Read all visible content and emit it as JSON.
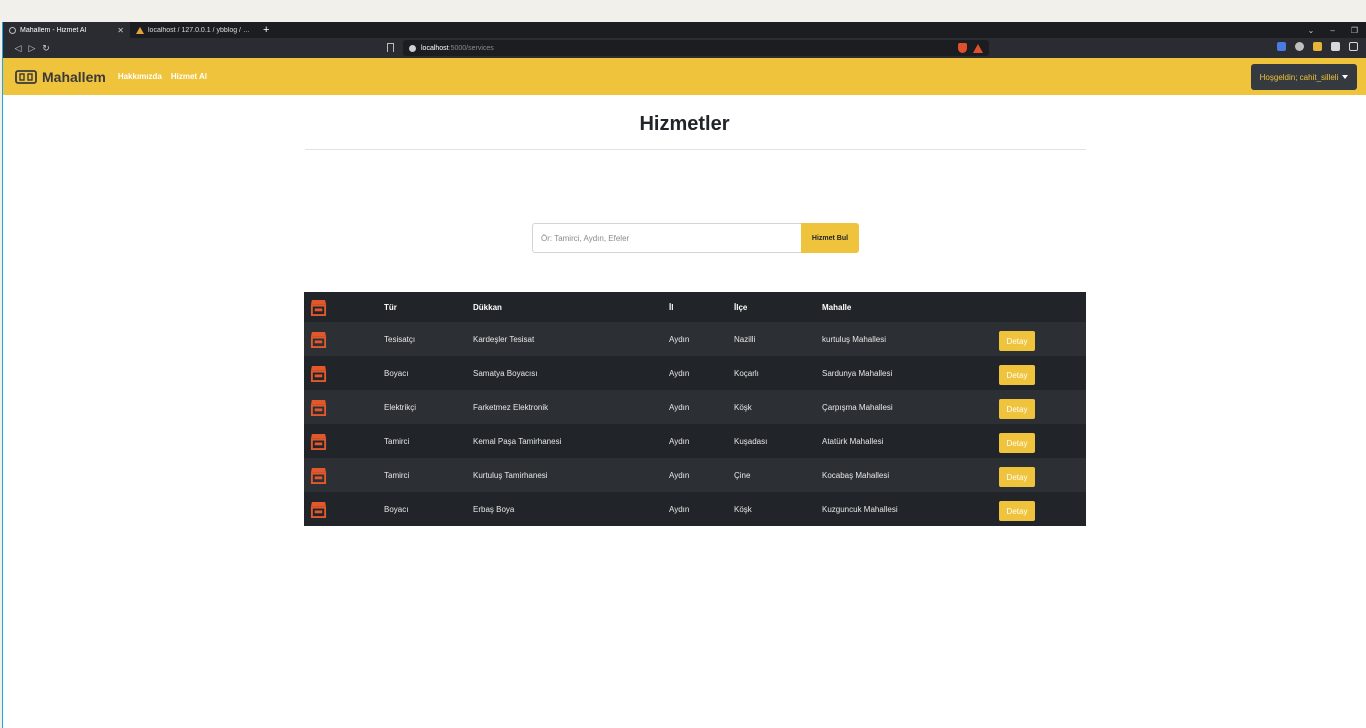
{
  "browser": {
    "tabs": [
      {
        "title": "Mahallem - Hizmet Al",
        "active": true
      },
      {
        "title": "localhost / 127.0.0.1 / ybblog / users |",
        "active": false
      }
    ],
    "new_tab": "+",
    "window_controls": [
      "⌄",
      "–",
      "❐"
    ],
    "url_host": "localhost",
    "url_path": ":5000/services"
  },
  "header": {
    "brand": "Mahallem",
    "nav": [
      "Hakkımızda",
      "Hizmet Al"
    ],
    "user_menu": "Hoşgeldin; cahit_silleli"
  },
  "main": {
    "title": "Hizmetler",
    "search": {
      "placeholder": "Ör: Tamirci, Aydın, Efeler",
      "button": "Hizmet Bul"
    },
    "table": {
      "headers": [
        "",
        "Tür",
        "Dükkan",
        "İl",
        "İlçe",
        "Mahalle",
        ""
      ],
      "detail_label": "Detay",
      "rows": [
        {
          "tur": "Tesisatçı",
          "dukkan": "Kardeşler Tesisat",
          "il": "Aydın",
          "ilce": "Nazilli",
          "mahalle": "kurtuluş Mahallesi"
        },
        {
          "tur": "Boyacı",
          "dukkan": "Samatya Boyacısı",
          "il": "Aydın",
          "ilce": "Koçarlı",
          "mahalle": "Sardunya Mahallesi"
        },
        {
          "tur": "Elektrikçi",
          "dukkan": "Farketmez Elektronik",
          "il": "Aydın",
          "ilce": "Köşk",
          "mahalle": "Çarpışma Mahallesi"
        },
        {
          "tur": "Tamirci",
          "dukkan": "Kemal Paşa Tamirhanesi",
          "il": "Aydın",
          "ilce": "Kuşadası",
          "mahalle": "Atatürk Mahallesi"
        },
        {
          "tur": "Tamirci",
          "dukkan": "Kurtuluş Tamirhanesi",
          "il": "Aydın",
          "ilce": "Çine",
          "mahalle": "Kocabaş Mahallesi"
        },
        {
          "tur": "Boyacı",
          "dukkan": "Erbaş Boya",
          "il": "Aydın",
          "ilce": "Köşk",
          "mahalle": "Kuzguncuk Mahallesi"
        }
      ]
    }
  },
  "icons": {
    "row_icon": "shop-icon",
    "logo": "logo-icon"
  },
  "colors": {
    "brand_yellow": "#f0c33c",
    "table_dark": "#212529",
    "icon_orange": "#e0582b"
  }
}
